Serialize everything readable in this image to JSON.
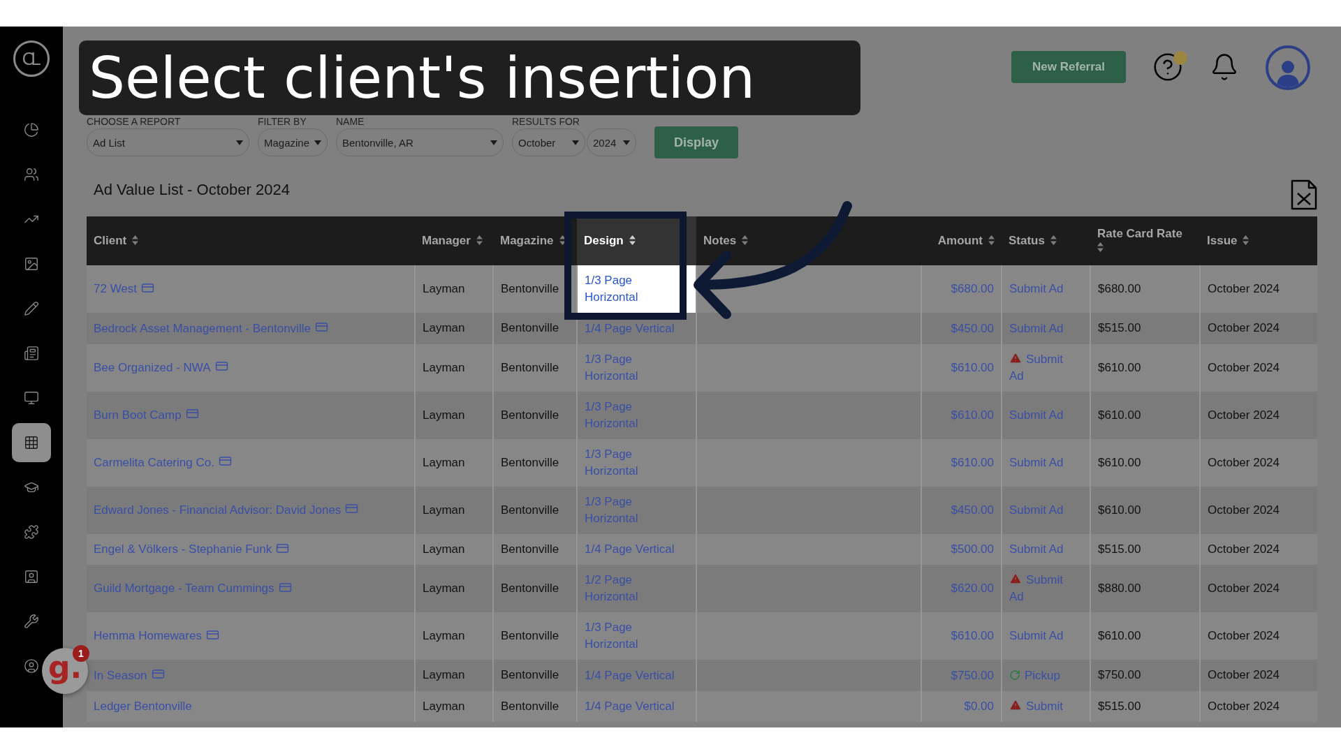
{
  "caption": "Select client's insertion",
  "sidebar": {
    "logo": "CL",
    "items": [
      {
        "selected": false
      },
      {
        "selected": false
      },
      {
        "selected": false
      },
      {
        "selected": false
      },
      {
        "selected": false
      },
      {
        "selected": false
      },
      {
        "selected": false
      },
      {
        "selected": true
      },
      {
        "selected": false
      },
      {
        "selected": false
      },
      {
        "selected": false
      },
      {
        "selected": false
      },
      {
        "selected": false
      }
    ]
  },
  "header": {
    "new_referral": "New Referral",
    "help_notification": true
  },
  "filters": [
    {
      "label": "CHOOSE A REPORT",
      "value": "Ad List"
    },
    {
      "label": "FILTER BY",
      "value": "Magazine"
    },
    {
      "label": "NAME",
      "value": "Bentonville, AR"
    },
    {
      "label": "RESULTS FOR",
      "value": "October"
    },
    {
      "value": "2024"
    }
  ],
  "display_button": "Display",
  "title": "Ad Value List - October 2024",
  "table": {
    "columns": [
      {
        "label": "Client",
        "highlighted": false
      },
      {
        "label": "Manager",
        "highlighted": false
      },
      {
        "label": "Magazine",
        "highlighted": false
      },
      {
        "label": "Design",
        "highlighted": true
      },
      {
        "label": "Notes",
        "highlighted": false
      },
      {
        "label": "Amount",
        "highlighted": false
      },
      {
        "label": "Status",
        "highlighted": false
      },
      {
        "label": "Rate Card Rate",
        "highlighted": false
      },
      {
        "label": "Issue",
        "highlighted": false
      }
    ],
    "rows": [
      {
        "client": "72 West",
        "card": true,
        "manager": "Layman",
        "magazine": "Bentonville",
        "design": "1/3 Page Horizontal",
        "highlighted": true,
        "amount": "$680.00",
        "status": {
          "text": "Submit Ad",
          "kind": "plain"
        },
        "rate": "$680.00",
        "issue": "October 2024"
      },
      {
        "client": "Bedrock Asset Management - Bentonville",
        "card": true,
        "manager": "Layman",
        "magazine": "Bentonville",
        "design": "1/4 Page Vertical",
        "highlighted": false,
        "amount": "$450.00",
        "status": {
          "text": "Submit Ad",
          "kind": "plain"
        },
        "rate": "$515.00",
        "issue": "October 2024"
      },
      {
        "client": "Bee Organized - NWA",
        "card": true,
        "manager": "Layman",
        "magazine": "Bentonville",
        "design": "1/3 Page Horizontal",
        "highlighted": false,
        "amount": "$610.00",
        "status": {
          "text": "Submit Ad",
          "kind": "warning"
        },
        "rate": "$610.00",
        "issue": "October 2024"
      },
      {
        "client": "Burn Boot Camp",
        "card": true,
        "manager": "Layman",
        "magazine": "Bentonville",
        "design": "1/3 Page Horizontal",
        "highlighted": false,
        "amount": "$610.00",
        "status": {
          "text": "Submit Ad",
          "kind": "plain"
        },
        "rate": "$610.00",
        "issue": "October 2024"
      },
      {
        "client": "Carmelita Catering Co.",
        "card": true,
        "manager": "Layman",
        "magazine": "Bentonville",
        "design": "1/3 Page Horizontal",
        "highlighted": false,
        "amount": "$610.00",
        "status": {
          "text": "Submit Ad",
          "kind": "plain"
        },
        "rate": "$610.00",
        "issue": "October 2024"
      },
      {
        "client": "Edward Jones - Financial Advisor: David Jones",
        "card": true,
        "manager": "Layman",
        "magazine": "Bentonville",
        "design": "1/3 Page Horizontal",
        "highlighted": false,
        "amount": "$450.00",
        "status": {
          "text": "Submit Ad",
          "kind": "plain"
        },
        "rate": "$610.00",
        "issue": "October 2024"
      },
      {
        "client": "Engel & Völkers - Stephanie Funk",
        "card": true,
        "manager": "Layman",
        "magazine": "Bentonville",
        "design": "1/4 Page Vertical",
        "highlighted": false,
        "amount": "$500.00",
        "status": {
          "text": "Submit Ad",
          "kind": "plain"
        },
        "rate": "$515.00",
        "issue": "October 2024"
      },
      {
        "client": "Guild Mortgage - Team Cummings",
        "card": true,
        "manager": "Layman",
        "magazine": "Bentonville",
        "design": "1/2 Page Horizontal",
        "highlighted": false,
        "amount": "$620.00",
        "status": {
          "text": "Submit Ad",
          "kind": "warning"
        },
        "rate": "$880.00",
        "issue": "October 2024"
      },
      {
        "client": "Hemma Homewares",
        "card": true,
        "manager": "Layman",
        "magazine": "Bentonville",
        "design": "1/3 Page Horizontal",
        "highlighted": false,
        "amount": "$610.00",
        "status": {
          "text": "Submit Ad",
          "kind": "plain"
        },
        "rate": "$610.00",
        "issue": "October 2024"
      },
      {
        "client": "In Season",
        "card": true,
        "manager": "Layman",
        "magazine": "Bentonville",
        "design": "1/4 Page Vertical",
        "highlighted": false,
        "amount": "$750.00",
        "status": {
          "text": "Pickup",
          "kind": "pickup"
        },
        "rate": "$750.00",
        "issue": "October 2024"
      },
      {
        "client": "Ledger Bentonville",
        "card": false,
        "manager": "Layman",
        "magazine": "Bentonville",
        "design": "1/4 Page Vertical",
        "highlighted": false,
        "amount": "$0.00",
        "status": {
          "text": "Submit",
          "kind": "warning"
        },
        "rate": "$515.00",
        "issue": "October 2024"
      }
    ]
  },
  "widget": {
    "letter": "g.",
    "count": "1"
  }
}
